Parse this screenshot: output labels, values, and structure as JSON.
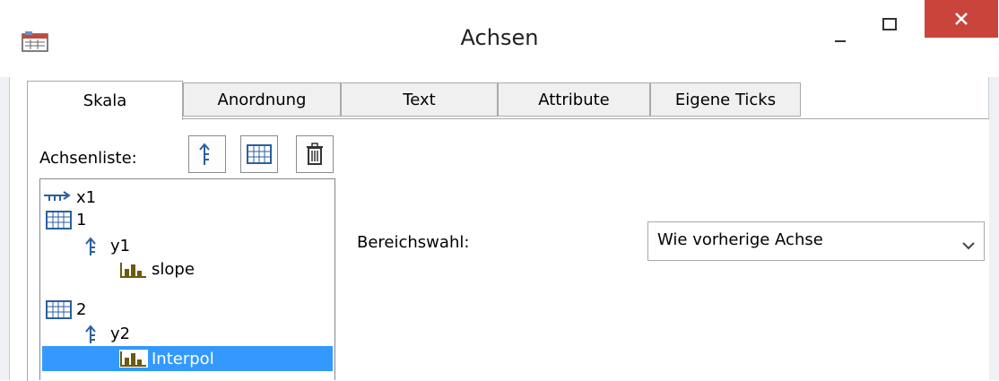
{
  "window": {
    "title": "Achsen"
  },
  "tabs": [
    {
      "label": "Skala",
      "active": true
    },
    {
      "label": "Anordnung",
      "active": false
    },
    {
      "label": "Text",
      "active": false
    },
    {
      "label": "Attribute",
      "active": false
    },
    {
      "label": "Eigene Ticks",
      "active": false
    }
  ],
  "scale": {
    "axis_list_label": "Achsenliste:",
    "toolbar": [
      "new-axis-icon",
      "new-system-icon",
      "delete-icon"
    ],
    "tree": [
      {
        "label": "x1",
        "icon": "x-axis-icon",
        "level": 0
      },
      {
        "label": "1",
        "icon": "coordinate-system-icon",
        "level": 0
      },
      {
        "label": "y1",
        "icon": "y-axis-icon",
        "level": 1
      },
      {
        "label": "slope",
        "icon": "channel-icon",
        "level": 2
      },
      {
        "label": "2",
        "icon": "coordinate-system-icon",
        "level": 0
      },
      {
        "label": "y2",
        "icon": "y-axis-icon",
        "level": 1
      },
      {
        "label": "Interpol",
        "icon": "channel-icon",
        "level": 2,
        "selected": true
      }
    ],
    "range_label": "Bereichswahl:",
    "range_value": "Wie vorherige Achse"
  },
  "colors": {
    "selection": "#3399ff",
    "close_button": "#c9453b",
    "axis_icon": "#2b5f9e"
  }
}
